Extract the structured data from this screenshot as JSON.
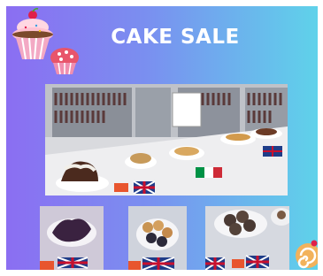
{
  "poster": {
    "title": "CAKE SALE",
    "colors": {
      "gradient_start": "#8b6ef2",
      "gradient_end": "#5fd2ea",
      "title_text": "#ffffff"
    }
  },
  "icons": [
    "cupcake-icon",
    "muffin-icon",
    "swiss-roll-icon"
  ],
  "photos": [
    "main-cake-table-photo",
    "brownies-photo",
    "muffins-photo",
    "cookies-photo"
  ]
}
